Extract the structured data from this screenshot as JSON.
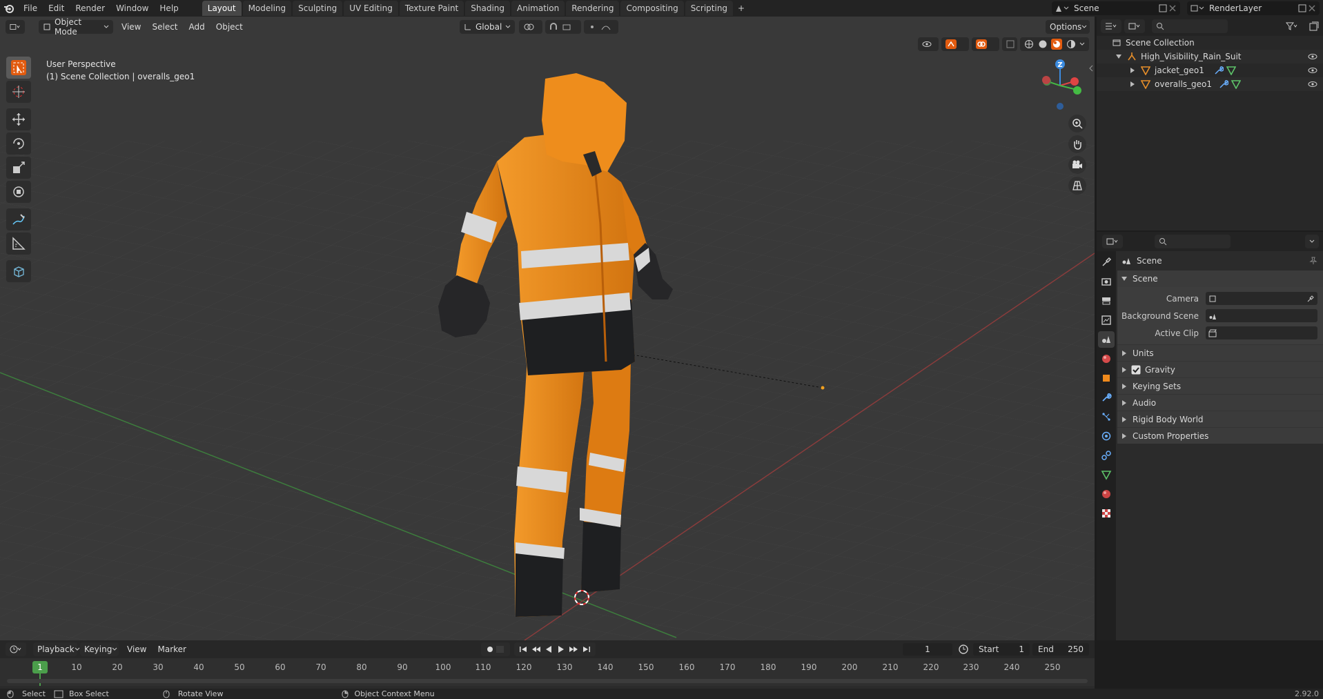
{
  "topbar": {
    "menus": [
      "File",
      "Edit",
      "Render",
      "Window",
      "Help"
    ],
    "workspaces": [
      "Layout",
      "Modeling",
      "Sculpting",
      "UV Editing",
      "Texture Paint",
      "Shading",
      "Animation",
      "Rendering",
      "Compositing",
      "Scripting"
    ],
    "active_workspace": "Layout",
    "add_tab": "+",
    "scene": "Scene",
    "render_layer": "RenderLayer"
  },
  "viewport": {
    "mode": "Object Mode",
    "menus": [
      "View",
      "Select",
      "Add",
      "Object"
    ],
    "orientation": "Global",
    "options": "Options",
    "perspective_label": "User Perspective",
    "collection_label": "(1) Scene Collection | overalls_geo1",
    "gizmo_axis": "Z"
  },
  "outliner": {
    "root": "Scene Collection",
    "items": [
      {
        "label": "High_Visibility_Rain_Suit",
        "level": 1
      },
      {
        "label": "jacket_geo1",
        "level": 2
      },
      {
        "label": "overalls_geo1",
        "level": 2
      }
    ]
  },
  "properties": {
    "context": "Scene",
    "panel_title": "Scene",
    "rows": [
      {
        "label": "Camera"
      },
      {
        "label": "Background Scene"
      },
      {
        "label": "Active Clip"
      }
    ],
    "subpanels": [
      "Units",
      "Gravity",
      "Keying Sets",
      "Audio",
      "Rigid Body World",
      "Custom Properties"
    ],
    "gravity_checked": true
  },
  "timeline": {
    "menus": [
      "Playback",
      "Keying",
      "View",
      "Marker"
    ],
    "current_frame": "1",
    "start_label": "Start",
    "start": "1",
    "end_label": "End",
    "end": "250",
    "ticks": [
      "1",
      "10",
      "20",
      "30",
      "40",
      "50",
      "60",
      "70",
      "80",
      "90",
      "100",
      "110",
      "120",
      "130",
      "140",
      "150",
      "160",
      "170",
      "180",
      "190",
      "200",
      "210",
      "220",
      "230",
      "240",
      "250"
    ]
  },
  "statusbar": {
    "select": "Select",
    "box_select": "Box Select",
    "rotate_view": "Rotate View",
    "context_menu": "Object Context Menu",
    "version": "2.92.0"
  },
  "colors": {
    "orange": "#e8820f",
    "orange_dark": "#c96c08",
    "reflective": "#d8d8d8",
    "black_fabric": "#222325",
    "accent": "#e8700e"
  }
}
